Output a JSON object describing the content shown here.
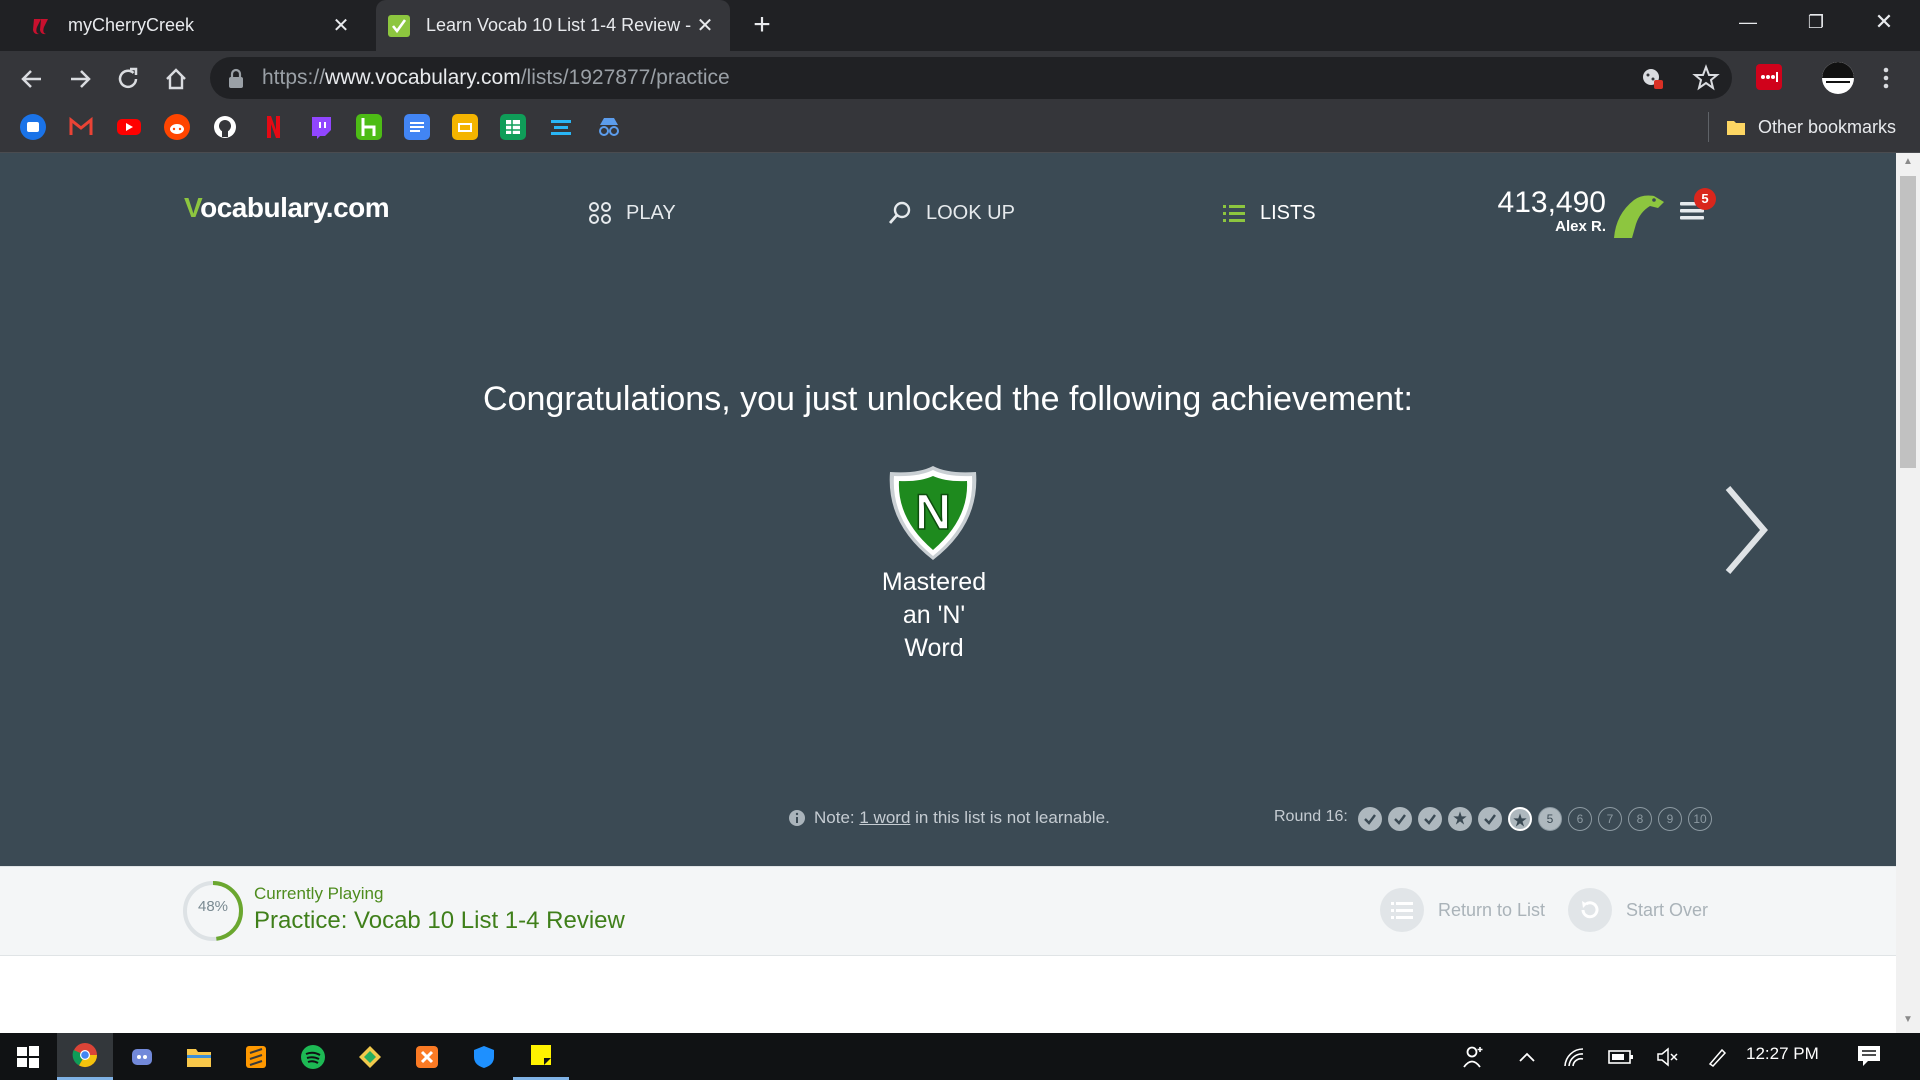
{
  "browser": {
    "tabs": [
      {
        "title": "myCherryCreek",
        "active": false
      },
      {
        "title": "Learn Vocab 10 List 1-4 Review -",
        "active": true
      }
    ],
    "url": {
      "scheme": "https://",
      "host": "www.vocabulary.com",
      "path": "/lists/1927877/practice"
    },
    "other_bookmarks": "Other bookmarks",
    "bookmarks": [
      "google-meet",
      "gmail",
      "youtube",
      "reddit",
      "github",
      "netflix",
      "twitch",
      "houzz",
      "google-docs",
      "google-slides",
      "google-sheets",
      "menu-app",
      "incognito-app"
    ]
  },
  "site": {
    "logo_v": "V",
    "logo_rest": "ocabulary.com",
    "nav": {
      "play": "PLAY",
      "lookup": "LOOK UP",
      "lists": "LISTS"
    },
    "score": "413,490",
    "user": "Alex R.",
    "notifications": "5"
  },
  "achievement": {
    "heading": "Congratulations, you just unlocked the following achievement:",
    "badge_letter": "N",
    "name_lines": [
      "Mastered",
      "an 'N'",
      "Word"
    ]
  },
  "footer_note": {
    "prefix": "Note:",
    "link": "1 word",
    "suffix": "in this list is not learnable."
  },
  "round": {
    "label": "Round 16:",
    "dots": [
      "check",
      "check",
      "check",
      "star",
      "check",
      "star-current",
      "5",
      "6",
      "7",
      "8",
      "9",
      "10"
    ]
  },
  "playing": {
    "label": "Currently Playing",
    "title": "Practice: Vocab 10 List 1-4 Review",
    "progress_pct": 48,
    "progress_text": "48%"
  },
  "actions": {
    "return": "Return to List",
    "start_over": "Start Over"
  },
  "taskbar": {
    "time": "12:27 PM"
  },
  "colors": {
    "page_bg": "#3b4a54",
    "accent_green": "#8dc63f",
    "badge_green": "#1e8a1e",
    "notif_red": "#d9261c"
  }
}
